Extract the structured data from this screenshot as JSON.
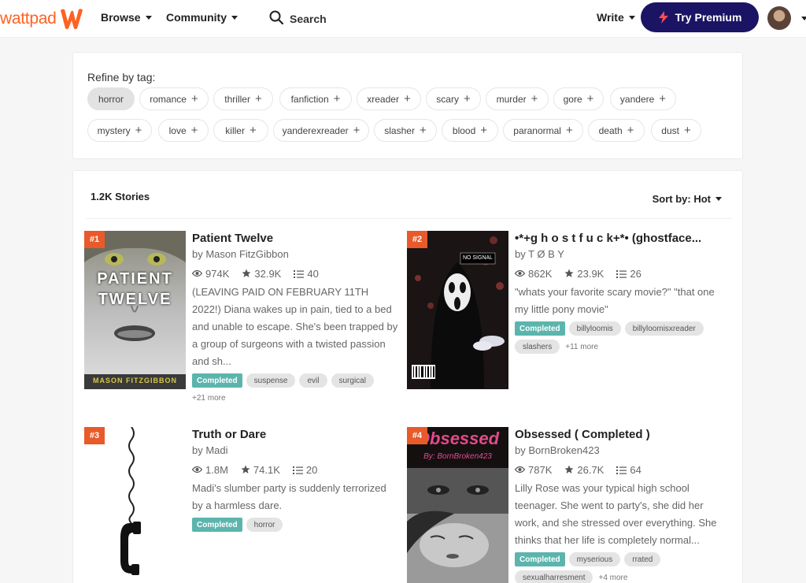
{
  "header": {
    "logo_text": "wattpad",
    "browse": "Browse",
    "community": "Community",
    "search_placeholder": "Search",
    "write": "Write",
    "premium": "Try Premium",
    "colors": {
      "brand": "#ff6122",
      "premium": "#1b1464"
    }
  },
  "tags": {
    "label": "Refine by tag:",
    "items": [
      "horror",
      "romance",
      "thriller",
      "fanfiction",
      "xreader",
      "scary",
      "murder",
      "gore",
      "yandere",
      "mystery",
      "love",
      "killer",
      "yanderexreader",
      "slasher",
      "blood",
      "paranormal",
      "death",
      "dust"
    ],
    "active": "horror"
  },
  "results": {
    "count": "1.2K Stories",
    "sort": "Sort by: Hot"
  },
  "stories": [
    {
      "rank": "#1",
      "title": "Patient Twelve",
      "author": "by Mason FitzGibbon",
      "reads": "974K",
      "votes": "32.9K",
      "parts": "40",
      "description": "(LEAVING PAID ON FEBRUARY 11TH 2022!) Diana wakes up in pain, tied to a bed and unable to escape. She's been trapped by a group of surgeons with a twisted passion and sh...",
      "completed": "Completed",
      "tags": [
        "suspense",
        "evil",
        "surgical"
      ],
      "more": "+21 more",
      "cover_title": "PATIENT TWELVE",
      "cover_author": "MASON FITZGIBBON"
    },
    {
      "rank": "#2",
      "title": "•*+g h o s t f u c k+*• (ghostface...",
      "author": "by T Ø B Y",
      "reads": "862K",
      "votes": "23.9K",
      "parts": "26",
      "description": "\"whats your favorite scary movie?\" \"that one my little pony movie\"",
      "completed": "Completed",
      "tags": [
        "billyloomis",
        "billyloomisxreader",
        "slashers"
      ],
      "more": "+11 more",
      "cover_text": "NO SIGNAL"
    },
    {
      "rank": "#3",
      "title": "Truth or Dare",
      "author": "by Madi",
      "reads": "1.8M",
      "votes": "74.1K",
      "parts": "20",
      "description": "Madi's slumber party is suddenly terrorized by a harmless dare.",
      "completed": "Completed",
      "tags": [
        "horror"
      ],
      "more": ""
    },
    {
      "rank": "#4",
      "title": "Obsessed ( Completed )",
      "author": "by BornBroken423",
      "reads": "787K",
      "votes": "26.7K",
      "parts": "64",
      "description": "Lilly Rose was your typical high school teenager. She went to party's, she did her work, and she stressed over everything. She thinks that her life is completely normal...",
      "completed": "Completed",
      "tags": [
        "myserious",
        "rrated",
        "sexualharresment"
      ],
      "more": "+4 more",
      "cover_title": "Obsessed",
      "cover_author": "By: BornBroken423"
    }
  ]
}
